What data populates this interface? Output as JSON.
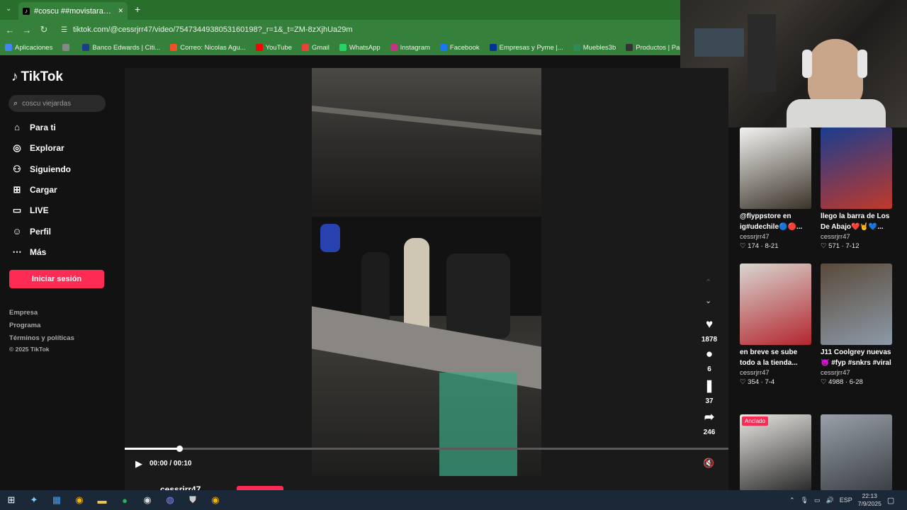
{
  "browser": {
    "tab_title": "#coscu ##movistararena #dulc",
    "tab_close": "✕",
    "new_tab": "+",
    "url": "tiktok.com/@cessrjrr47/video/7547344938053160198?_r=1&_t=ZM-8zXjhUa29m",
    "bookmarks": [
      {
        "label": "Aplicaciones",
        "color": "#4285f4"
      },
      {
        "label": "",
        "color": "#888888"
      },
      {
        "label": "Banco Edwards | Citi...",
        "color": "#1f3c88"
      },
      {
        "label": "Correo: Nicolas Agu...",
        "color": "#f25022"
      },
      {
        "label": "YouTube",
        "color": "#ff0000"
      },
      {
        "label": "Gmail",
        "color": "#ea4335"
      },
      {
        "label": "WhatsApp",
        "color": "#25d366"
      },
      {
        "label": "Instagram",
        "color": "#c13584"
      },
      {
        "label": "Facebook",
        "color": "#1877f2"
      },
      {
        "label": "Empresas y Pyme |...",
        "color": "#003399"
      },
      {
        "label": "Muebles3b",
        "color": "#2e8b57"
      },
      {
        "label": "Productos | Panel d...",
        "color": "#333333"
      },
      {
        "label": "StreamLadder | Edit...",
        "color": "#5b4bdb"
      }
    ]
  },
  "sidebar": {
    "logo_text": "TikTok",
    "search_placeholder": "coscu viejardas",
    "nav": [
      {
        "label": "Para ti",
        "icon": "home-icon",
        "glyph": "⌂"
      },
      {
        "label": "Explorar",
        "icon": "compass-icon",
        "glyph": "◎"
      },
      {
        "label": "Siguiendo",
        "icon": "following-icon",
        "glyph": "⚇"
      },
      {
        "label": "Cargar",
        "icon": "upload-icon",
        "glyph": "⊞"
      },
      {
        "label": "LIVE",
        "icon": "live-icon",
        "glyph": "▭"
      },
      {
        "label": "Perfil",
        "icon": "profile-icon",
        "glyph": "☺"
      },
      {
        "label": "Más",
        "icon": "more-icon",
        "glyph": "⋯"
      }
    ],
    "login_label": "Iniciar sesión",
    "footer": [
      "Empresa",
      "Programa",
      "Términos y políticas",
      "© 2025 TikTok"
    ]
  },
  "player": {
    "time": "00:00 / 00:10",
    "progress": 0.09,
    "username": "cessrjrr47",
    "actions": [
      {
        "name": "like",
        "icon": "heart-icon",
        "glyph": "♥",
        "count": "1878"
      },
      {
        "name": "comment",
        "icon": "comment-icon",
        "glyph": "●",
        "count": "6"
      },
      {
        "name": "save",
        "icon": "bookmark-icon",
        "glyph": "❚",
        "count": "37"
      },
      {
        "name": "share",
        "icon": "share-icon",
        "glyph": "➦",
        "count": "246"
      }
    ]
  },
  "grid": [
    {
      "title": "@flyppstore en ig#udechile🔵🔴...",
      "user": "cessrjrr47",
      "likes": "174",
      "date": "8-21",
      "colors": [
        "#f2f2f0",
        "#3a3328"
      ]
    },
    {
      "title": "llego la barra de Los De Abajo❤️🤘💙...",
      "user": "cessrjrr47",
      "likes": "571",
      "date": "7-12",
      "colors": [
        "#1a3d8f",
        "#c0392b"
      ]
    },
    {
      "title": "en breve se sube todo a la tienda...",
      "user": "cessrjrr47",
      "likes": "354",
      "date": "7-4",
      "colors": [
        "#d8d6d0",
        "#b3262e"
      ]
    },
    {
      "title": "J11 Coolgrey nuevas 😈 #fyp #snkrs #viral",
      "user": "cessrjrr47",
      "likes": "4988",
      "date": "6-28",
      "colors": [
        "#5a4a3a",
        "#8c9aa8"
      ]
    },
    {
      "title": "",
      "user": "",
      "likes": "",
      "date": "",
      "badge": "Anclado",
      "colors": [
        "#e8e6e2",
        "#2a2a2a"
      ]
    },
    {
      "title": "",
      "user": "",
      "likes": "",
      "date": "",
      "colors": [
        "#9aa0a8",
        "#3a3f45"
      ]
    }
  ],
  "taskbar": {
    "apps": [
      "windows-start-icon",
      "copilot-icon",
      "store-icon",
      "chrome-icon",
      "files-icon",
      "spotify-icon",
      "obs-icon",
      "discord-icon",
      "shield-app-icon",
      "chrome-alt-icon"
    ],
    "lang": "ESP",
    "time": "22:13",
    "date": "7/9/2025"
  }
}
